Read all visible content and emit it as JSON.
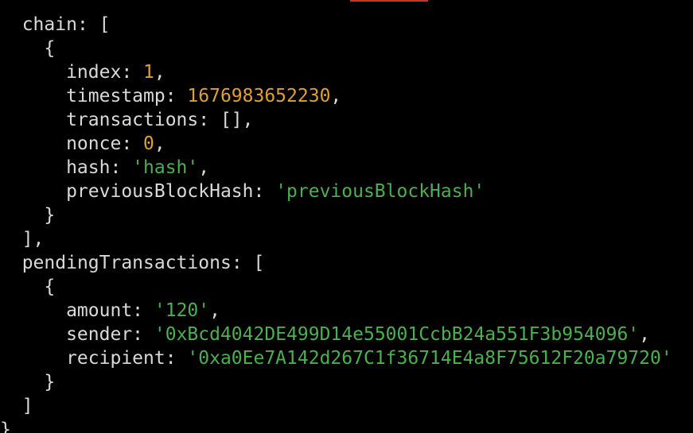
{
  "colors": {
    "background": "#000000",
    "text": "#d9d9d9",
    "number": "#e0a030",
    "string": "#4caf50",
    "accent": "#c0392b"
  },
  "output": {
    "chain_key": "chain",
    "chain": [
      {
        "index": "1",
        "timestamp": "1676983652230",
        "transactions": "[]",
        "nonce": "0",
        "hash": "'hash'",
        "previousBlockHash": "'previousBlockHash'"
      }
    ],
    "pending_key": "pendingTransactions",
    "pendingTransactions": [
      {
        "amount": "'120'",
        "sender": "'0xBcd4042DE499D14e55001CcbB24a551F3b954096'",
        "recipient": "'0xa0Ee7A142d267C1f36714E4a8F75612F20a79720'"
      }
    ]
  }
}
